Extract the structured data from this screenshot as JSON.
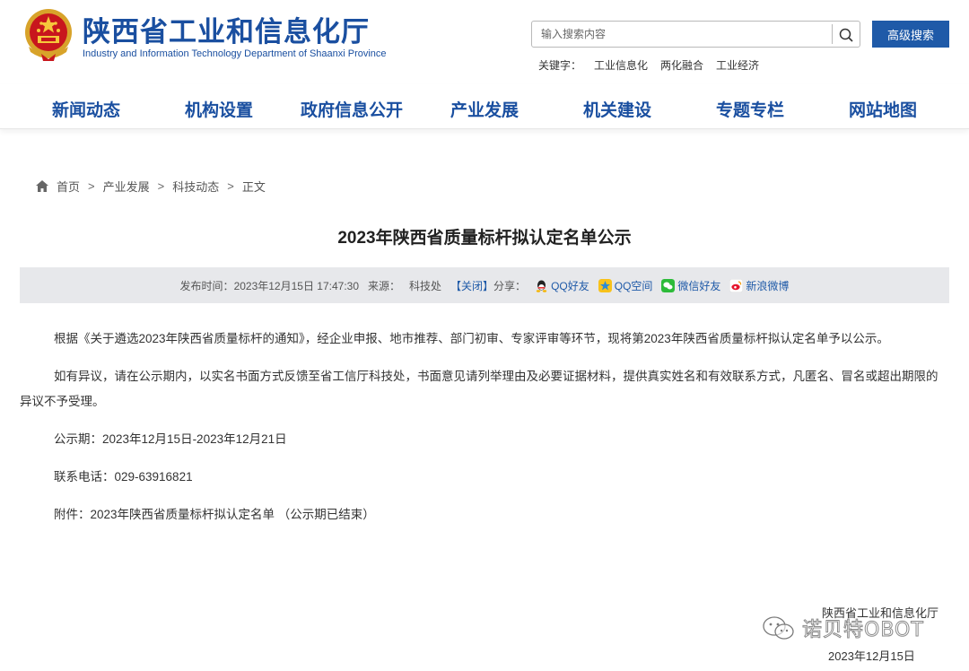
{
  "header": {
    "site_title": "陕西省工业和信息化厅",
    "site_subtitle": "Industry and Information Technology Department of Shaanxi Province",
    "search_placeholder": "输入搜索内容",
    "advanced_search_label": "高级搜索",
    "keywords_label": "关键字：",
    "keywords": [
      "工业信息化",
      "两化融合",
      "工业经济"
    ]
  },
  "nav": {
    "items": [
      "新闻动态",
      "机构设置",
      "政府信息公开",
      "产业发展",
      "机关建设",
      "专题专栏",
      "网站地图"
    ]
  },
  "breadcrumb": {
    "items": [
      "首页",
      "产业发展",
      "科技动态"
    ],
    "separator": ">",
    "current": "正文"
  },
  "article": {
    "title": "2023年陕西省质量标杆拟认定名单公示",
    "meta": {
      "publish_label": "发布时间：",
      "publish_time": "2023年12月15日 17:47:30",
      "source_label": "来源：",
      "source": "科技处",
      "close_label": "【关闭】",
      "share_label": "分享：",
      "share_items": [
        "QQ好友",
        "QQ空间",
        "微信好友",
        "新浪微博"
      ]
    },
    "paragraphs": [
      "根据《关于遴选2023年陕西省质量标杆的通知》，经企业申报、地市推荐、部门初审、专家评审等环节，现将第2023年陕西省质量标杆拟认定名单予以公示。",
      "如有异议，请在公示期内，以实名书面方式反馈至省工信厅科技处，书面意见请列举理由及必要证据材料，提供真实姓名和有效联系方式，凡匿名、冒名或超出期限的异议不予受理。",
      "公示期：2023年12月15日-2023年12月21日",
      "联系电话：029-63916821",
      "附件：2023年陕西省质量标杆拟认定名单 （公示期已结束）"
    ],
    "signature_org": "陕西省工业和信息化厅",
    "signature_date": "2023年12月15日"
  },
  "watermark": {
    "text": "诺贝特OBOT"
  },
  "colors": {
    "brand_blue": "#1a4fa0",
    "button_blue": "#1f5aa8",
    "meta_bar_bg": "#e7e8eb"
  }
}
